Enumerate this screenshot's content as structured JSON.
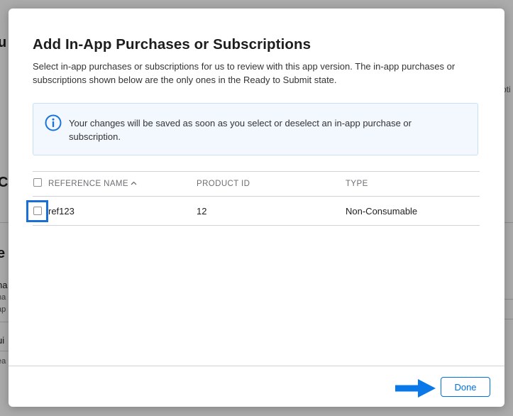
{
  "background": {
    "fragments": [
      {
        "text": "u",
        "size": 20,
        "weight": "bold"
      },
      {
        "text": "pti",
        "size": 12,
        "weight": "normal"
      },
      {
        "text": "C",
        "size": 20,
        "weight": "bold"
      },
      {
        "text": "e",
        "size": 20,
        "weight": "bold"
      },
      {
        "text": "na",
        "size": 13,
        "weight": "normal"
      },
      {
        "text": "na",
        "size": 11,
        "weight": "normal"
      },
      {
        "text": "ap",
        "size": 11,
        "weight": "normal"
      },
      {
        "text": "ui",
        "size": 13,
        "weight": "normal"
      },
      {
        "text": "ea",
        "size": 11,
        "weight": "normal"
      }
    ]
  },
  "modal": {
    "title": "Add In-App Purchases or Subscriptions",
    "description": "Select in-app purchases or subscriptions for us to review with this app version. The in-app purchases or subscriptions shown below are the only ones in the Ready to Submit state.",
    "info": {
      "icon": "info-circle-icon",
      "text": "Your changes will be saved as soon as you select or deselect an in-app purchase or subscription."
    },
    "table": {
      "columns": [
        "REFERENCE NAME",
        "PRODUCT ID",
        "TYPE"
      ],
      "sort_icon": "chevron-up-icon",
      "rows": [
        {
          "reference_name": "ref123",
          "product_id": "12",
          "type": "Non-Consumable",
          "checked": false
        }
      ]
    },
    "done_label": "Done"
  },
  "colors": {
    "accent": "#0071e3",
    "highlight": "#1a6fd4",
    "arrow": "#0a78e8",
    "info_icon": "#1a73d9"
  }
}
